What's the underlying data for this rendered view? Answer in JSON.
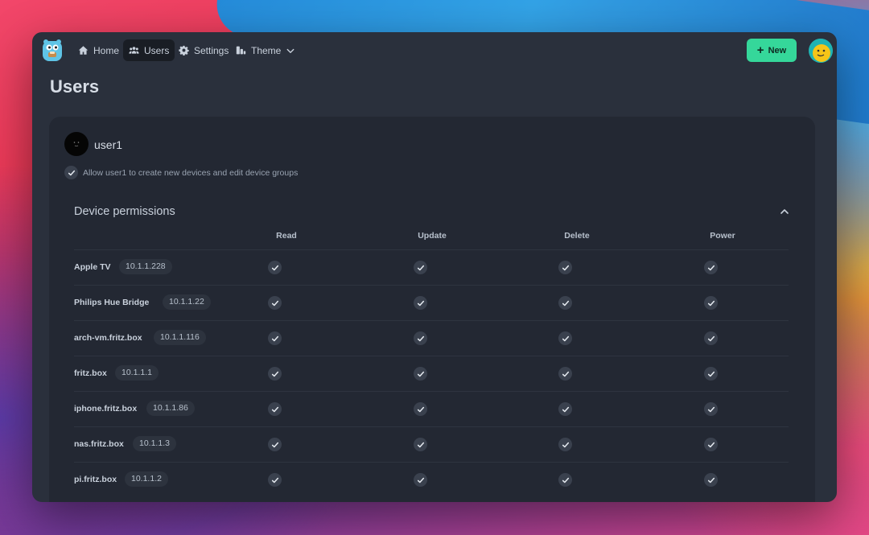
{
  "nav": {
    "items": [
      {
        "label": "Home",
        "icon": "home-icon"
      },
      {
        "label": "Users",
        "icon": "users-icon"
      },
      {
        "label": "Settings",
        "icon": "gear-icon"
      },
      {
        "label": "Theme",
        "icon": "theme-icon"
      }
    ],
    "new_label": "New"
  },
  "page": {
    "title": "Users"
  },
  "user": {
    "name": "user1",
    "allow_text": "Allow user1 to create new devices and edit device groups"
  },
  "permissions": {
    "title": "Device permissions",
    "columns": [
      "Read",
      "Update",
      "Delete",
      "Power"
    ],
    "rows": [
      {
        "name": "Apple TV",
        "ip": "10.1.1.228",
        "read": true,
        "update": true,
        "delete": true,
        "power": true
      },
      {
        "name": "Philips Hue Bridge",
        "ip": "10.1.1.22",
        "read": true,
        "update": true,
        "delete": true,
        "power": true
      },
      {
        "name": "arch-vm.fritz.box",
        "ip": "10.1.1.116",
        "read": true,
        "update": true,
        "delete": true,
        "power": true
      },
      {
        "name": "fritz.box",
        "ip": "10.1.1.1",
        "read": true,
        "update": true,
        "delete": true,
        "power": true
      },
      {
        "name": "iphone.fritz.box",
        "ip": "10.1.1.86",
        "read": true,
        "update": true,
        "delete": true,
        "power": true
      },
      {
        "name": "nas.fritz.box",
        "ip": "10.1.1.3",
        "read": true,
        "update": true,
        "delete": true,
        "power": true
      },
      {
        "name": "pi.fritz.box",
        "ip": "10.1.1.2",
        "read": true,
        "update": true,
        "delete": true,
        "power": true
      }
    ]
  },
  "colors": {
    "accent": "#35d79a",
    "background": "#2a303c",
    "card": "#232833"
  }
}
